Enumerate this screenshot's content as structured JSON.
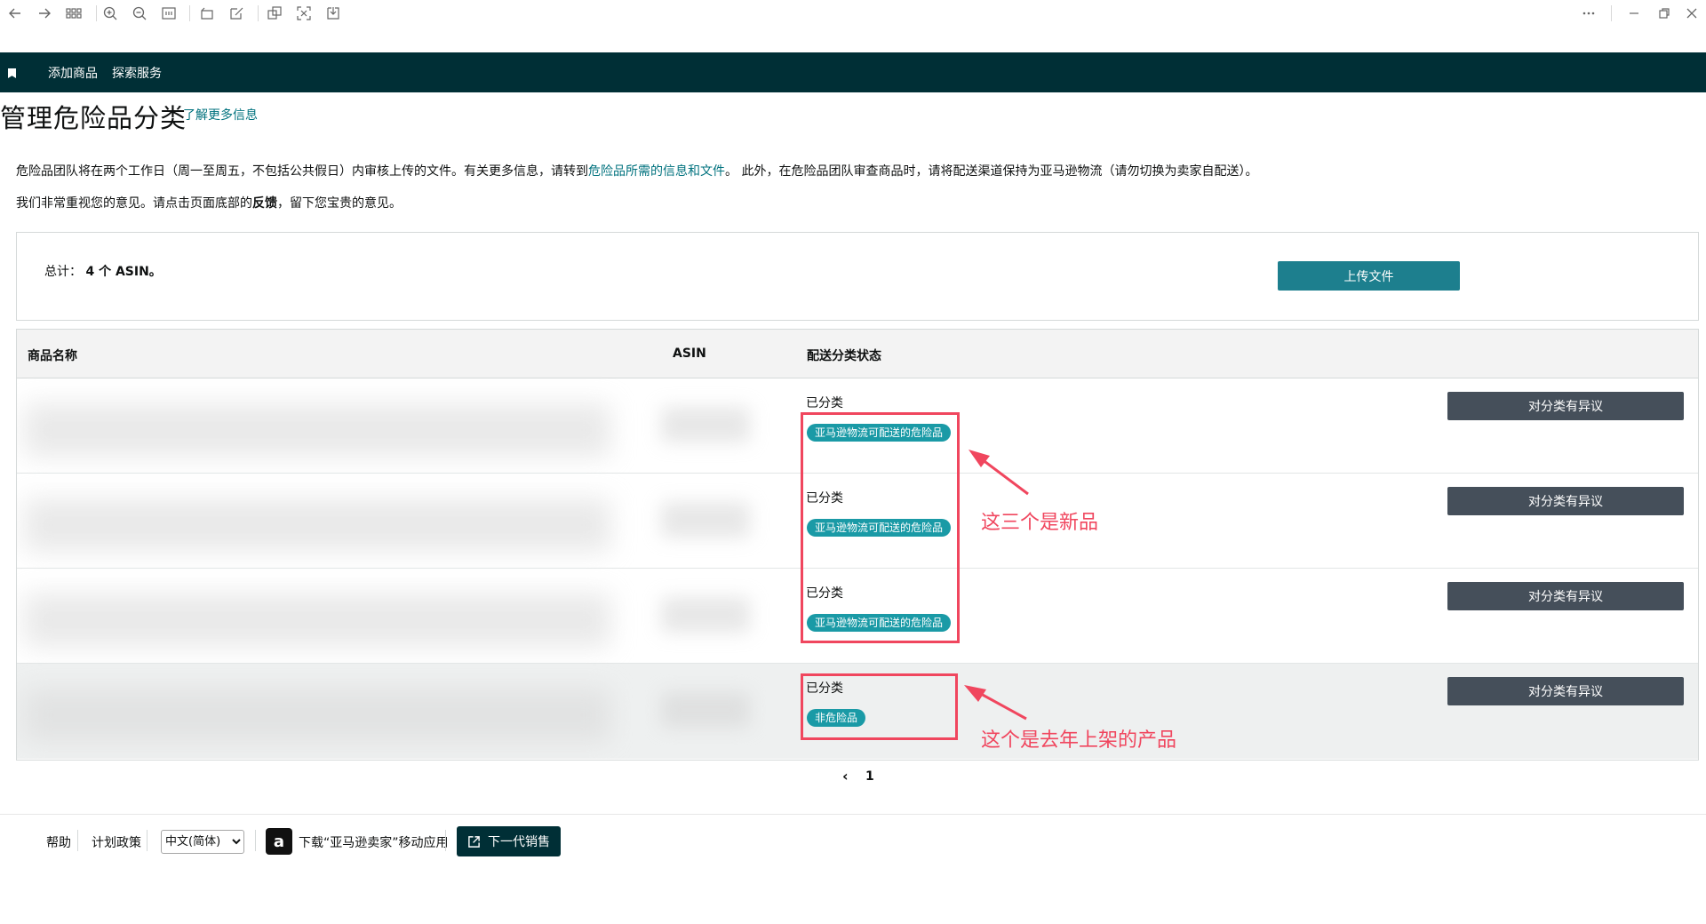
{
  "nav": {
    "items": [
      "添加商品",
      "探索服务"
    ]
  },
  "header": {
    "title": "管理危险品分类",
    "learn_more": "了解更多信息"
  },
  "info": {
    "line1_a": "危险品团队将在两个工作日（周一至周五，不包括公共假日）内审核上传的文件。有关更多信息，请转到",
    "line1_link": "危险品所需的信息和文件",
    "line1_b": "。 此外，在危险品团队审查商品时，请将配送渠道保持为亚马逊物流（请勿切换为卖家自配送）。",
    "line2_a": "我们非常重视您的意见。请点击页面底部的",
    "line2_bold": "反馈",
    "line2_b": "，留下您宝贵的意见。"
  },
  "summary": {
    "label": "总计：",
    "count": "4 个 ASIN。",
    "upload_button": "上传文件"
  },
  "table": {
    "headers": {
      "name": "商品名称",
      "asin": "ASIN",
      "status": "配送分类状态"
    },
    "rows": [
      {
        "status": "已分类",
        "badge": "亚马逊物流可配送的危险品",
        "action": "对分类有异议"
      },
      {
        "status": "已分类",
        "badge": "亚马逊物流可配送的危险品",
        "action": "对分类有异议"
      },
      {
        "status": "已分类",
        "badge": "亚马逊物流可配送的危险品",
        "action": "对分类有异议"
      },
      {
        "status": "已分类",
        "badge": "非危险品",
        "action": "对分类有异议"
      }
    ]
  },
  "annotations": {
    "new_products": "这三个是新品",
    "last_year": "这个是去年上架的产品"
  },
  "pagination": {
    "prev": "‹",
    "current": "1"
  },
  "footer": {
    "help": "帮助",
    "policy": "计划政策",
    "language": "中文(简体)",
    "app_text": "下载“亚马逊卖家”移动应用",
    "next_gen": "下一代销售"
  },
  "colors": {
    "nav_bg": "#002f36",
    "accent": "#1d7f8e",
    "badge": "#1a9aa6",
    "annotation": "#f0465e",
    "dispute_button": "#454f5a"
  }
}
